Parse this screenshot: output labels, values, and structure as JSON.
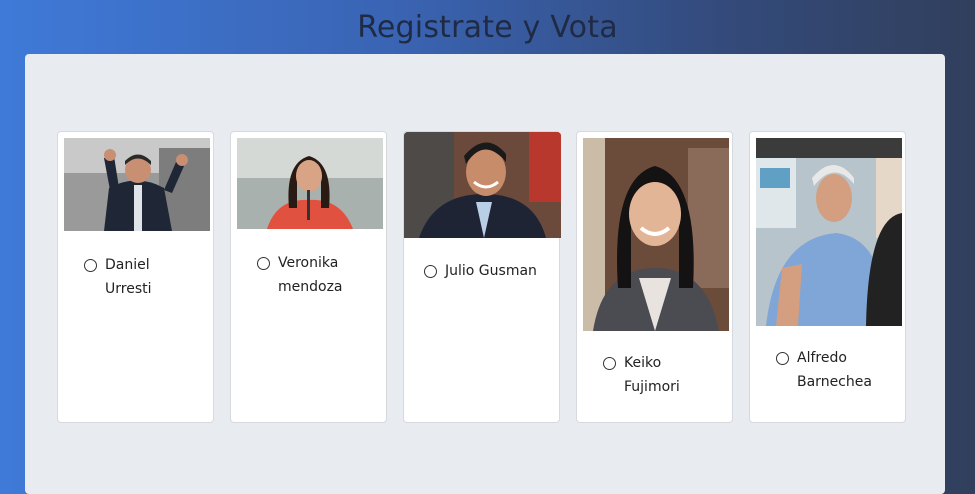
{
  "header": {
    "title": "Registrate y Vota"
  },
  "candidates": [
    {
      "name_line1": "Daniel",
      "name_line2": "Urresti",
      "photo_icon": "candidate-photo-thumbs-up"
    },
    {
      "name_line1": "Veronika",
      "name_line2": "mendoza",
      "photo_icon": "candidate-photo-speaking"
    },
    {
      "name_line1": "Julio Gusman",
      "name_line2": "",
      "photo_icon": "candidate-photo-smiling"
    },
    {
      "name_line1": "Keiko",
      "name_line2": "Fujimori",
      "photo_icon": "candidate-photo-portrait"
    },
    {
      "name_line1": "Alfredo",
      "name_line2": "Barnechea",
      "photo_icon": "candidate-photo-crowd"
    }
  ]
}
